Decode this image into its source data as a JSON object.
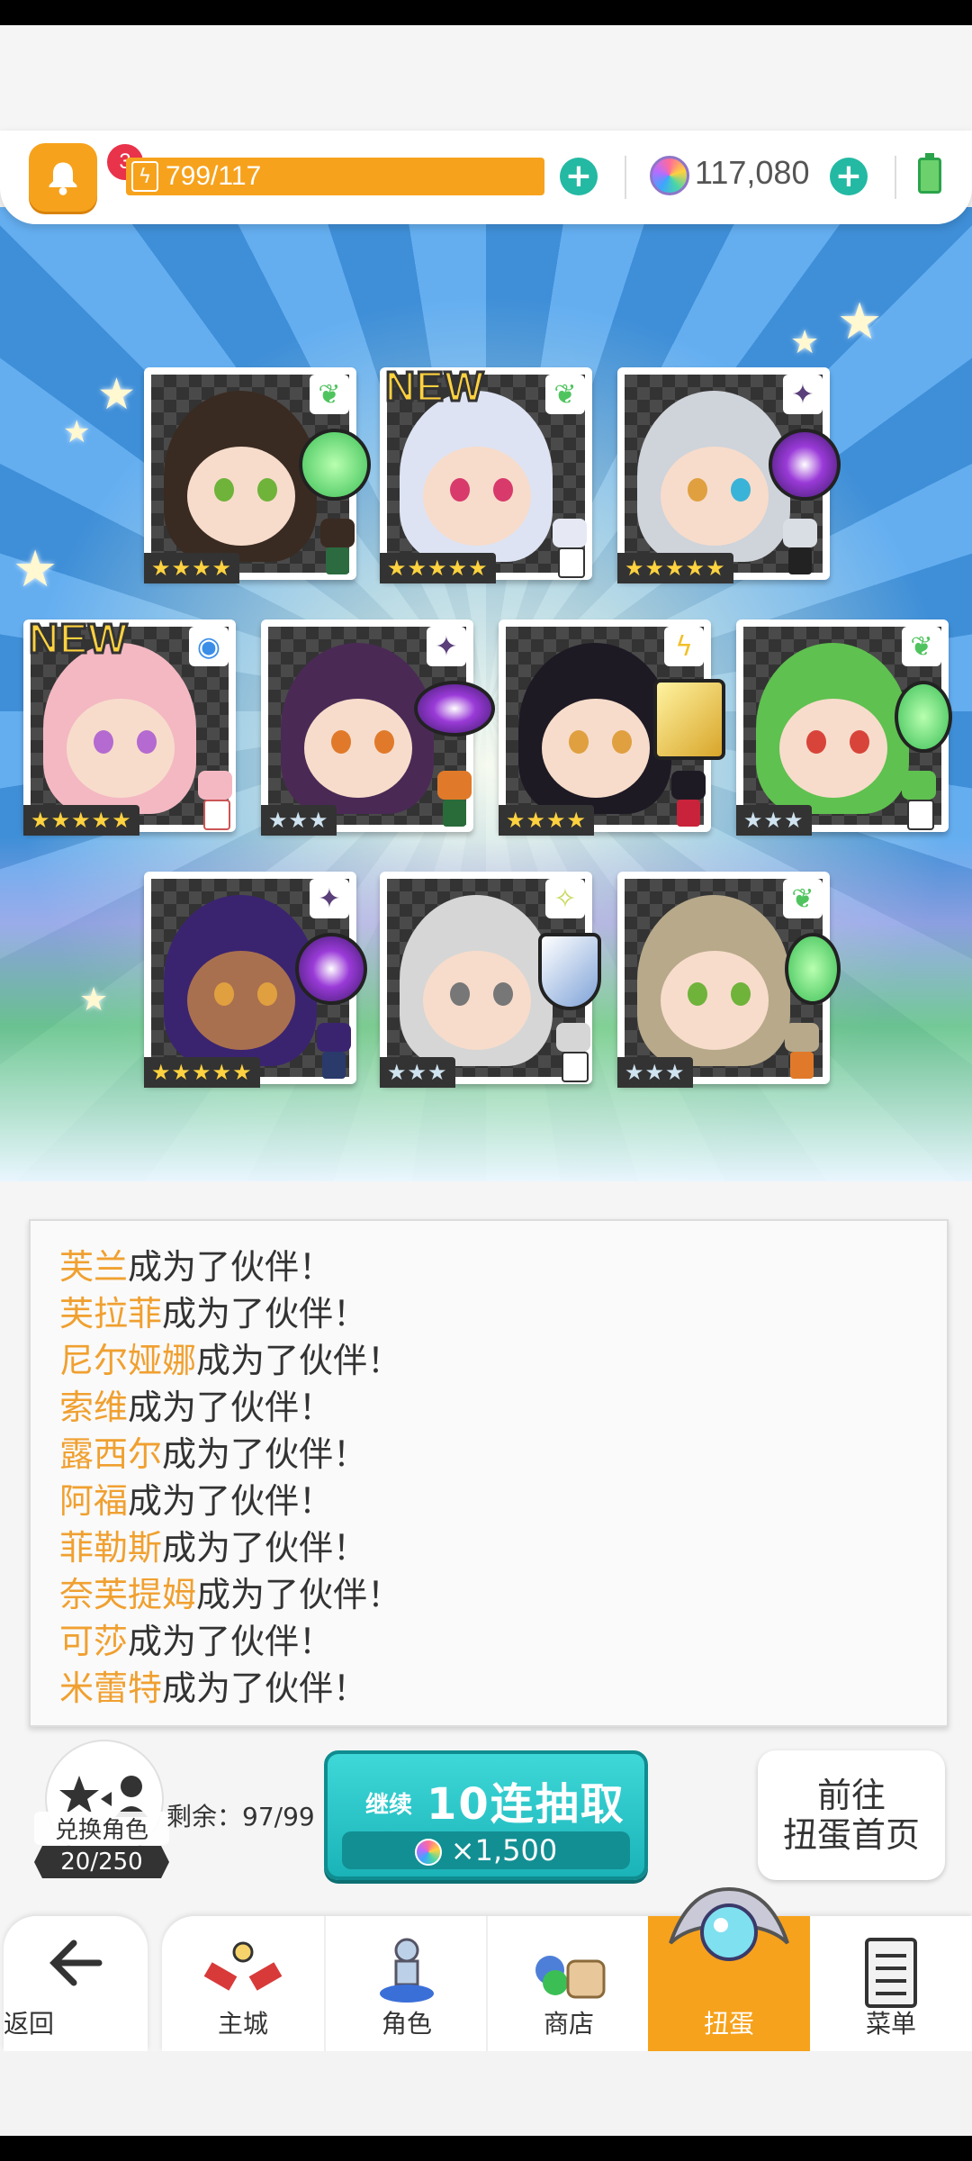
{
  "topbar": {
    "notification_count": "3",
    "energy_text": "799/117",
    "gem_count": "117,080"
  },
  "cards": [
    {
      "name_hint": "card-1",
      "stars": "★★★★",
      "element_icon": "leaf-icon",
      "new": false
    },
    {
      "name_hint": "card-2",
      "stars": "★★★★★",
      "element_icon": "leaf-icon",
      "new": true
    },
    {
      "name_hint": "card-3",
      "stars": "★★★★★",
      "element_icon": "dark-star-icon",
      "new": false
    },
    {
      "name_hint": "card-4",
      "stars": "★★★★★",
      "element_icon": "water-circle-icon",
      "new": true
    },
    {
      "name_hint": "card-5",
      "stars": "★★★",
      "element_icon": "dark-star-icon",
      "new": false
    },
    {
      "name_hint": "card-6",
      "stars": "★★★★",
      "element_icon": "lightning-icon",
      "new": false
    },
    {
      "name_hint": "card-7",
      "stars": "★★★",
      "element_icon": "leaf-icon",
      "new": false
    },
    {
      "name_hint": "card-8",
      "stars": "★★★★★",
      "element_icon": "dark-star-icon",
      "new": false
    },
    {
      "name_hint": "card-9",
      "stars": "★★★",
      "element_icon": "light-star-icon",
      "new": false
    },
    {
      "name_hint": "card-10",
      "stars": "★★★",
      "element_icon": "leaf-icon",
      "new": false
    }
  ],
  "new_label": "NEW",
  "log": {
    "suffix": "成为了伙伴！",
    "entries": [
      "芙兰",
      "芙拉菲",
      "尼尔娅娜",
      "索维",
      "露西尔",
      "阿福",
      "菲勒斯",
      "奈芙提姆",
      "可莎",
      "米蕾特"
    ]
  },
  "exchange": {
    "label": "兑换角色",
    "count": "20/250",
    "remain": "剩余：97/99"
  },
  "pull_button": {
    "small_label": "继续",
    "big_label": "10连抽取",
    "cost": "×1,500"
  },
  "home_button": {
    "line1": "前往",
    "line2": "扭蛋首页"
  },
  "nav": {
    "back": "返回",
    "items": [
      "主城",
      "角色",
      "商店",
      "扭蛋",
      "菜单"
    ],
    "active": "扭蛋"
  },
  "colors": {
    "accent_orange": "#f7a21c",
    "teal": "#23b9a3",
    "log_name": "#f0a030"
  }
}
